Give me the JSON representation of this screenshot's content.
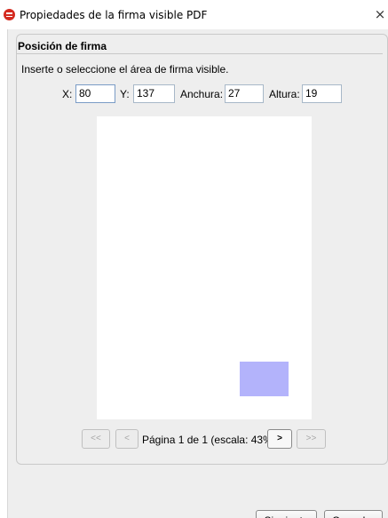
{
  "window": {
    "title": "Propiedades de la firma visible PDF",
    "close_glyph": "×"
  },
  "group": {
    "title": "Posición de firma",
    "instruction": "Inserte o seleccione el área de firma visible."
  },
  "fields": {
    "x_label": "X:",
    "x_value": "80",
    "y_label": "Y:",
    "y_value": "137",
    "width_label": "Anchura:",
    "width_value": "27",
    "height_label": "Altura:",
    "height_value": "19"
  },
  "preview": {
    "signature_area_color": "#b3b3fb"
  },
  "navigation": {
    "first_label": "<<",
    "prev_label": "<",
    "page_info": "Página 1 de 1 (escala: 43%)",
    "next_label": ">",
    "last_label": ">>"
  },
  "buttons": {
    "next_label": "Siguiente",
    "cancel_mnemonic": "C",
    "cancel_rest": "ancelar"
  },
  "icons": {
    "app": "pdf-signature-app-icon",
    "close": "close-icon"
  }
}
